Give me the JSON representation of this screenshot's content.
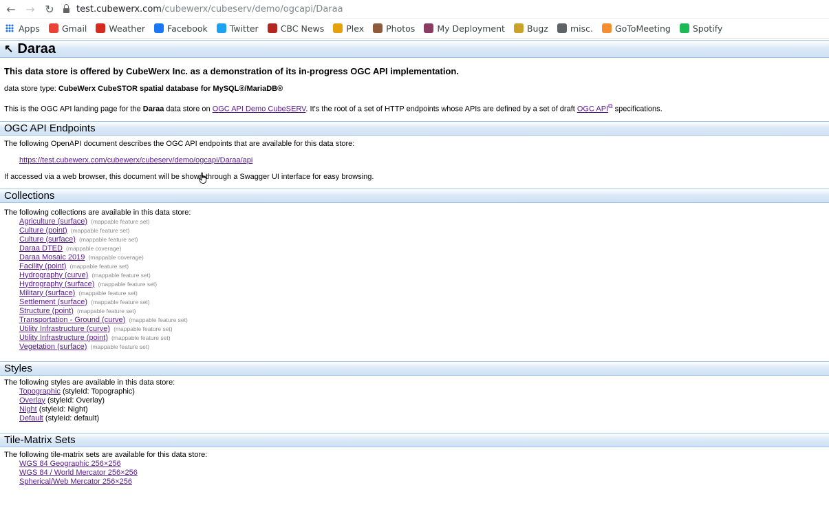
{
  "browser": {
    "url_host": "test.cubewerx.com",
    "url_path": "/cubewerx/cubeserv/demo/ogcapi/Daraa",
    "bookmarks": [
      {
        "label": "Apps",
        "color": "#1a73e8"
      },
      {
        "label": "Gmail",
        "color": "#ea4335"
      },
      {
        "label": "Weather",
        "color": "#d52b1e"
      },
      {
        "label": "Facebook",
        "color": "#1877f2"
      },
      {
        "label": "Twitter",
        "color": "#1da1f2"
      },
      {
        "label": "CBC News",
        "color": "#b3261e"
      },
      {
        "label": "Plex",
        "color": "#e5a00d"
      },
      {
        "label": "Photos",
        "color": "#8e5a3a"
      },
      {
        "label": "My Deployment",
        "color": "#8b3a62"
      },
      {
        "label": "Bugz",
        "color": "#c9a227"
      },
      {
        "label": "misc.",
        "color": "#5f6368"
      },
      {
        "label": "GoToMeeting",
        "color": "#f68d2e"
      },
      {
        "label": "Spotify",
        "color": "#1db954"
      }
    ]
  },
  "page": {
    "title": "Daraa",
    "intro": "This data store is offered by CubeWerx Inc. as a demonstration of its in-progress OGC API implementation.",
    "store_type_label": "data store type: ",
    "store_type_value": "CubeWerx CubeSTOR spatial database for MySQL®/MariaDB®",
    "landing_pre": "This is the OGC API landing page for the ",
    "landing_name": "Daraa",
    "landing_mid": " data store on ",
    "landing_link": "OGC API Demo CubeSERV",
    "landing_mid2": ". It's the root of a set of HTTP endpoints whose APIs are defined by a set of draft ",
    "landing_link2": "OGC API",
    "landing_post": " specifications."
  },
  "endpoints": {
    "heading": "OGC API Endpoints",
    "desc": "The following OpenAPI document describes the OGC API endpoints that are available for this data store:",
    "link": "https://test.cubewerx.com/cubewerx/cubeserv/demo/ogcapi/Daraa/api",
    "note": "If accessed via a web browser, this document will be shown through a Swagger UI interface for easy browsing."
  },
  "collections": {
    "heading": "Collections",
    "desc": "The following collections are available in this data store:",
    "items": [
      {
        "name": "Agriculture (surface)",
        "type": "(mappable feature set)"
      },
      {
        "name": "Culture (point)",
        "type": "(mappable feature set)"
      },
      {
        "name": "Culture (surface)",
        "type": "(mappable feature set)"
      },
      {
        "name": "Daraa DTED",
        "type": "(mappable coverage)"
      },
      {
        "name": "Daraa Mosaic 2019",
        "type": "(mappable coverage)"
      },
      {
        "name": "Facility (point)",
        "type": "(mappable feature set)"
      },
      {
        "name": "Hydrography (curve)",
        "type": "(mappable feature set)"
      },
      {
        "name": "Hydrography (surface)",
        "type": "(mappable feature set)"
      },
      {
        "name": "Military (surface)",
        "type": "(mappable feature set)"
      },
      {
        "name": "Settlement (surface)",
        "type": "(mappable feature set)"
      },
      {
        "name": "Structure (point)",
        "type": "(mappable feature set)"
      },
      {
        "name": "Transportation - Ground (curve)",
        "type": "(mappable feature set)"
      },
      {
        "name": "Utility Infrastructure (curve)",
        "type": "(mappable feature set)"
      },
      {
        "name": "Utility Infrastructure (point)",
        "type": "(mappable feature set)"
      },
      {
        "name": "Vegetation (surface)",
        "type": "(mappable feature set)"
      }
    ]
  },
  "styles": {
    "heading": "Styles",
    "desc": "The following styles are available in this data store:",
    "items": [
      {
        "name": "Topographic",
        "id": "(styleId: Topographic)"
      },
      {
        "name": "Overlay",
        "id": "(styleId: Overlay)"
      },
      {
        "name": "Night",
        "id": "(styleId: Night)"
      },
      {
        "name": "Default",
        "id": "(styleId: default)"
      }
    ]
  },
  "tms": {
    "heading": "Tile-Matrix Sets",
    "desc": "The following tile-matrix sets are available for this data store:",
    "items": [
      "WGS 84 Geographic 256×256",
      "WGS 84 / World Mercator 256×256",
      "Spherical/Web Mercator 256×256"
    ]
  }
}
